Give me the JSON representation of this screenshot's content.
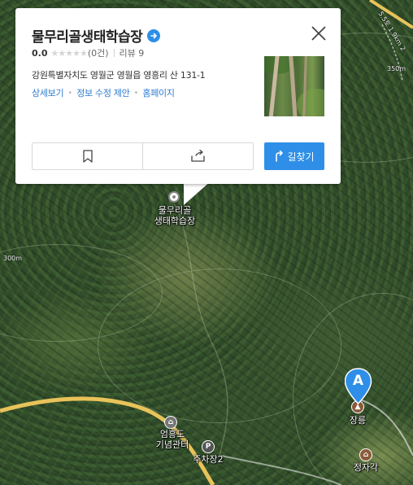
{
  "place": {
    "title": "물무리골생태학습장",
    "rating_score": "0.0",
    "stars": "★★★★★",
    "review_count": "(0건)",
    "review_label": "리뷰 9",
    "address": "강원특별자치도 영월군 영월읍 영흥리 산 131-1",
    "links": [
      "상세보기",
      "정보 수정 제안",
      "홈페이지"
    ],
    "route_label": "길찾기"
  },
  "map": {
    "labels": {
      "learning_center": "물무리골\n생태학습장",
      "memorial_hall": "엄흥도\n기념관터",
      "parking": "주차장2",
      "jangneung": "장릉",
      "jeongjagak": "정자각",
      "contour_300m": "300m",
      "contour_350m": "350m",
      "trail": "5.5토 1.9km 2",
      "marker_letter": "A"
    }
  },
  "colors": {
    "accent": "#2f8fe8",
    "link": "#2d7bd1",
    "road": "#e8c35a"
  },
  "icons": [
    "arrow-right-icon",
    "close-icon",
    "bookmark-icon",
    "share-icon",
    "route-icon",
    "place-dot-icon",
    "museum-icon",
    "parking-icon",
    "tomb-icon",
    "pavilion-icon",
    "location-marker-icon"
  ]
}
